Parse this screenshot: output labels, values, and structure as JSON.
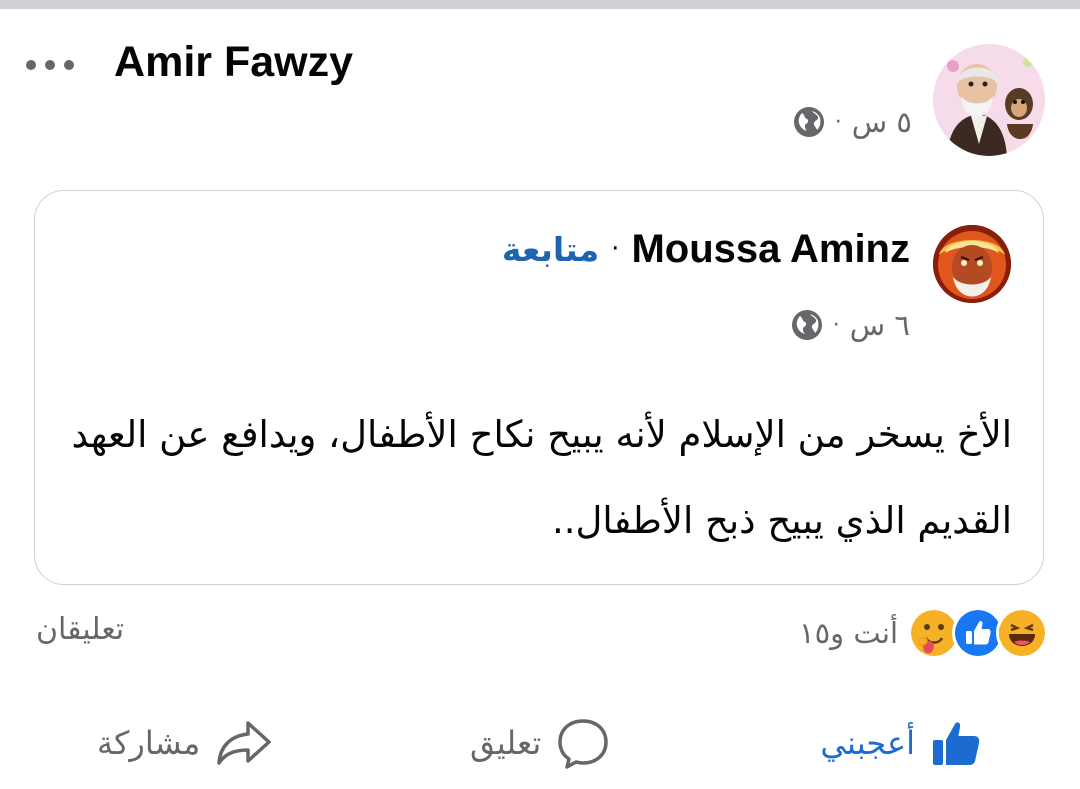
{
  "post": {
    "author": "Amir Fawzy",
    "time": "٥ س",
    "separator": "·"
  },
  "shared_post": {
    "author": "Moussa Aminz",
    "separator": "·",
    "follow_label": "متابعة",
    "time": "٦ س",
    "text": "الأخ يسخر من الإسلام لأنه يبيح نكاح الأطفال، ويدافع عن العهد القديم الذي يبيح ذبح الأطفال.."
  },
  "reactions": {
    "icons": [
      "haha-icon",
      "like-icon",
      "care-icon"
    ],
    "count_text": "أنت و١٥"
  },
  "comments_count": "تعليقان",
  "actions": {
    "like": "أعجبني",
    "comment": "تعليق",
    "share": "مشاركة"
  },
  "colors": {
    "accent_blue": "#1b6bd0",
    "follow_blue": "#1f64b0",
    "secondary_text": "#65676b",
    "card_border": "#d0d2d6"
  }
}
